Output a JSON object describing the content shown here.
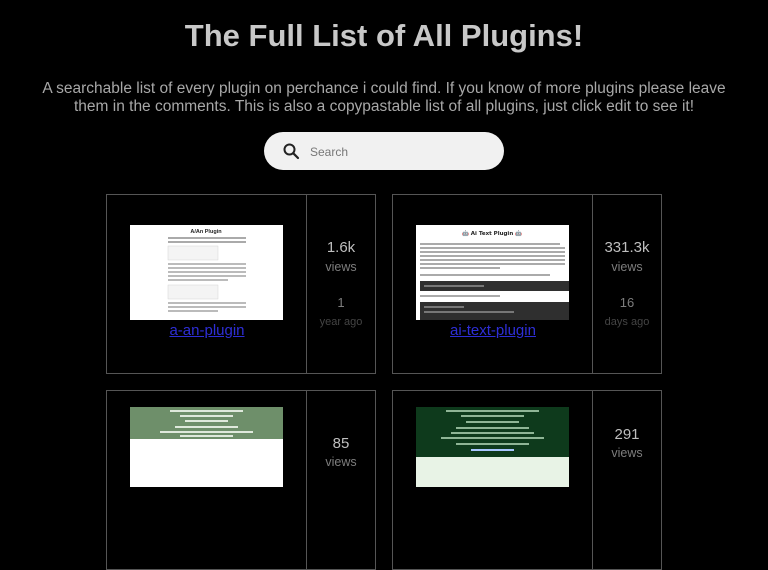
{
  "header": {
    "title": "The Full List of All Plugins!",
    "subtitle": "A searchable list of every plugin on perchance i could find. If you know of more plugins please leave them in the comments. This is also a copypastable list of all plugins, just click edit to see it!"
  },
  "search": {
    "placeholder": "Search",
    "value": ""
  },
  "plugins": [
    {
      "name": "a-an-plugin",
      "views": "1.6k",
      "views_label": "views",
      "age_num": "1",
      "age_label": "year ago",
      "thumb_title": "A/An Plugin"
    },
    {
      "name": "ai-text-plugin",
      "views": "331.3k",
      "views_label": "views",
      "age_num": "16",
      "age_label": "days ago",
      "thumb_title": "🤖 Ai Text Plugin 🤖"
    },
    {
      "name": "",
      "views": "85",
      "views_label": "views",
      "age_num": "",
      "age_label": ""
    },
    {
      "name": "",
      "views": "291",
      "views_label": "views",
      "age_num": "",
      "age_label": ""
    }
  ],
  "colors": {
    "background": "#000000",
    "link": "#2e2ed6",
    "border": "#555555"
  }
}
